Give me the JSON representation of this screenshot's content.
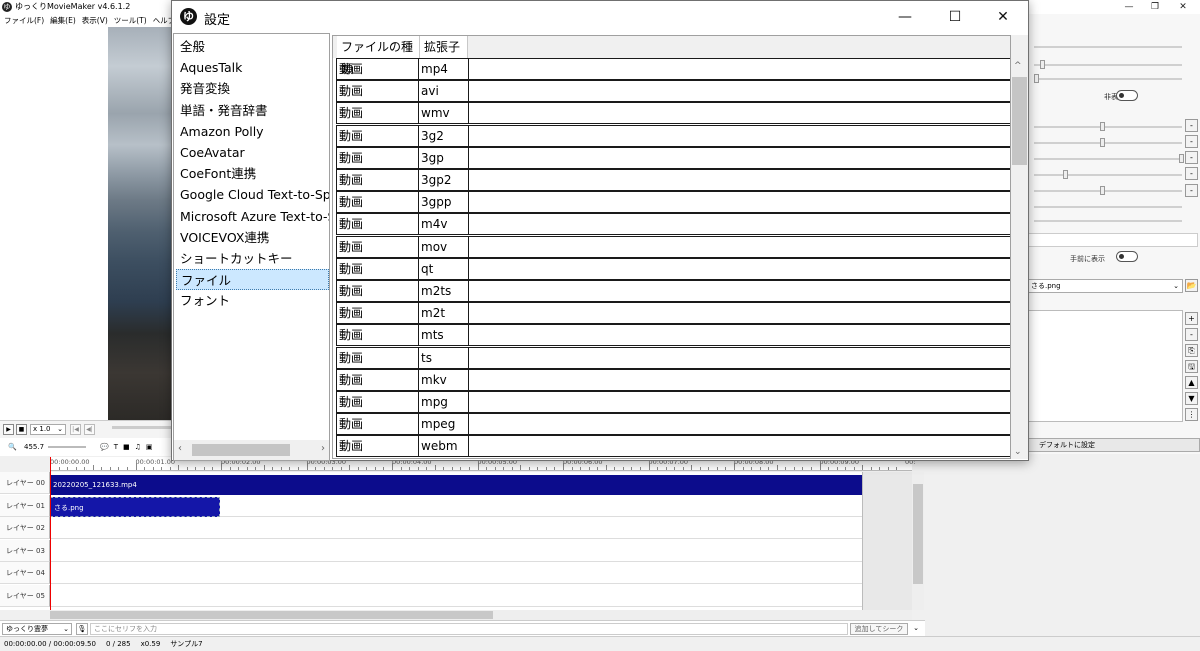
{
  "app": {
    "title": "ゆっくりMovieMaker v4.6.1.2",
    "logo_text": "ゆ",
    "menu": [
      "ファイル(F)",
      "編集(E)",
      "表示(V)",
      "ツール(T)",
      "ヘルプ(H)"
    ],
    "window_controls": {
      "minimize": "—",
      "maximize": "❐",
      "close": "✕"
    }
  },
  "player": {
    "play_icon": "▶",
    "stop_icon": "■",
    "speed": "x 1.0",
    "speed_arrow": "⌄",
    "prev_icon": "|◀",
    "step_back_icon": "◀|"
  },
  "toolbar": {
    "zoom_icon": "🔍",
    "zoom_value": "455.7",
    "tool_icons": [
      "💬",
      "T",
      "■",
      "♫",
      "▣"
    ]
  },
  "timeline": {
    "ticks": [
      "00:00:00.00",
      "00:00:01.00",
      "00:00:02.00",
      "00:00:03.00",
      "00:00:04.00",
      "00:00:05.00",
      "00:00:06.00",
      "00:00:07.00",
      "00:00:08.00",
      "00:00:09.00",
      "00:"
    ],
    "layers": [
      "レイヤー 00",
      "レイヤー 01",
      "レイヤー 02",
      "レイヤー 03",
      "レイヤー 04",
      "レイヤー 05"
    ],
    "clips": {
      "video": "20220205_121633.mp4",
      "image": "さる.png"
    }
  },
  "bottom": {
    "voice": "ゆっくり霊夢",
    "voice_arrow": "⌄",
    "dialogue_placeholder": "ここにセリフを入力",
    "add_seek": "追加してシーク",
    "add_seek_arrow": "⌄"
  },
  "status": {
    "time": "00:00:00.00  /  00:00:09.50",
    "frames": "0  /  285",
    "scale": "x0.59",
    "sample": "サンプル7"
  },
  "right_panel": {
    "hide_label": "非表示",
    "front_label": "手前に表示",
    "file_value": "さる.png",
    "file_arrow": "⌄",
    "folder_icon": "📂",
    "default_button": "デフォルトに設定",
    "list_buttons": [
      "+",
      "-",
      "⎘",
      "🖫",
      "▲",
      "▼",
      "⋮"
    ],
    "minus_buttons": [
      "-",
      "-",
      "-",
      "-",
      "-"
    ]
  },
  "dialog": {
    "logo_text": "ゆ",
    "title": "設定",
    "controls": {
      "minimize": "—",
      "maximize": "☐",
      "close": "✕"
    },
    "categories": [
      "全般",
      "AquesTalk",
      "発音変換",
      "単語・発音辞書",
      "Amazon Polly",
      "CoeAvatar",
      "CoeFont連携",
      "Google Cloud Text-to-Speech",
      "Microsoft Azure Text-to-Speech",
      "VOICEVOX連携",
      "ショートカットキー",
      "ファイル",
      "フォント"
    ],
    "selected_category": "ファイル",
    "scroll_left": "‹",
    "scroll_right": "›",
    "scroll_up": "^",
    "scroll_down": "⌄",
    "columns": {
      "type": "ファイルの種類",
      "ext": "拡張子"
    },
    "rows": [
      {
        "type": "動画",
        "ext": "mp4"
      },
      {
        "type": "動画",
        "ext": "avi"
      },
      {
        "type": "動画",
        "ext": "wmv"
      },
      {
        "type": "動画",
        "ext": "3g2"
      },
      {
        "type": "動画",
        "ext": "3gp"
      },
      {
        "type": "動画",
        "ext": "3gp2"
      },
      {
        "type": "動画",
        "ext": "3gpp"
      },
      {
        "type": "動画",
        "ext": "m4v"
      },
      {
        "type": "動画",
        "ext": "mov"
      },
      {
        "type": "動画",
        "ext": "qt"
      },
      {
        "type": "動画",
        "ext": "m2ts"
      },
      {
        "type": "動画",
        "ext": "m2t"
      },
      {
        "type": "動画",
        "ext": "mts"
      },
      {
        "type": "動画",
        "ext": "ts"
      },
      {
        "type": "動画",
        "ext": "mkv"
      },
      {
        "type": "動画",
        "ext": "mpg"
      },
      {
        "type": "動画",
        "ext": "mpeg"
      },
      {
        "type": "動画",
        "ext": "webm"
      }
    ]
  }
}
